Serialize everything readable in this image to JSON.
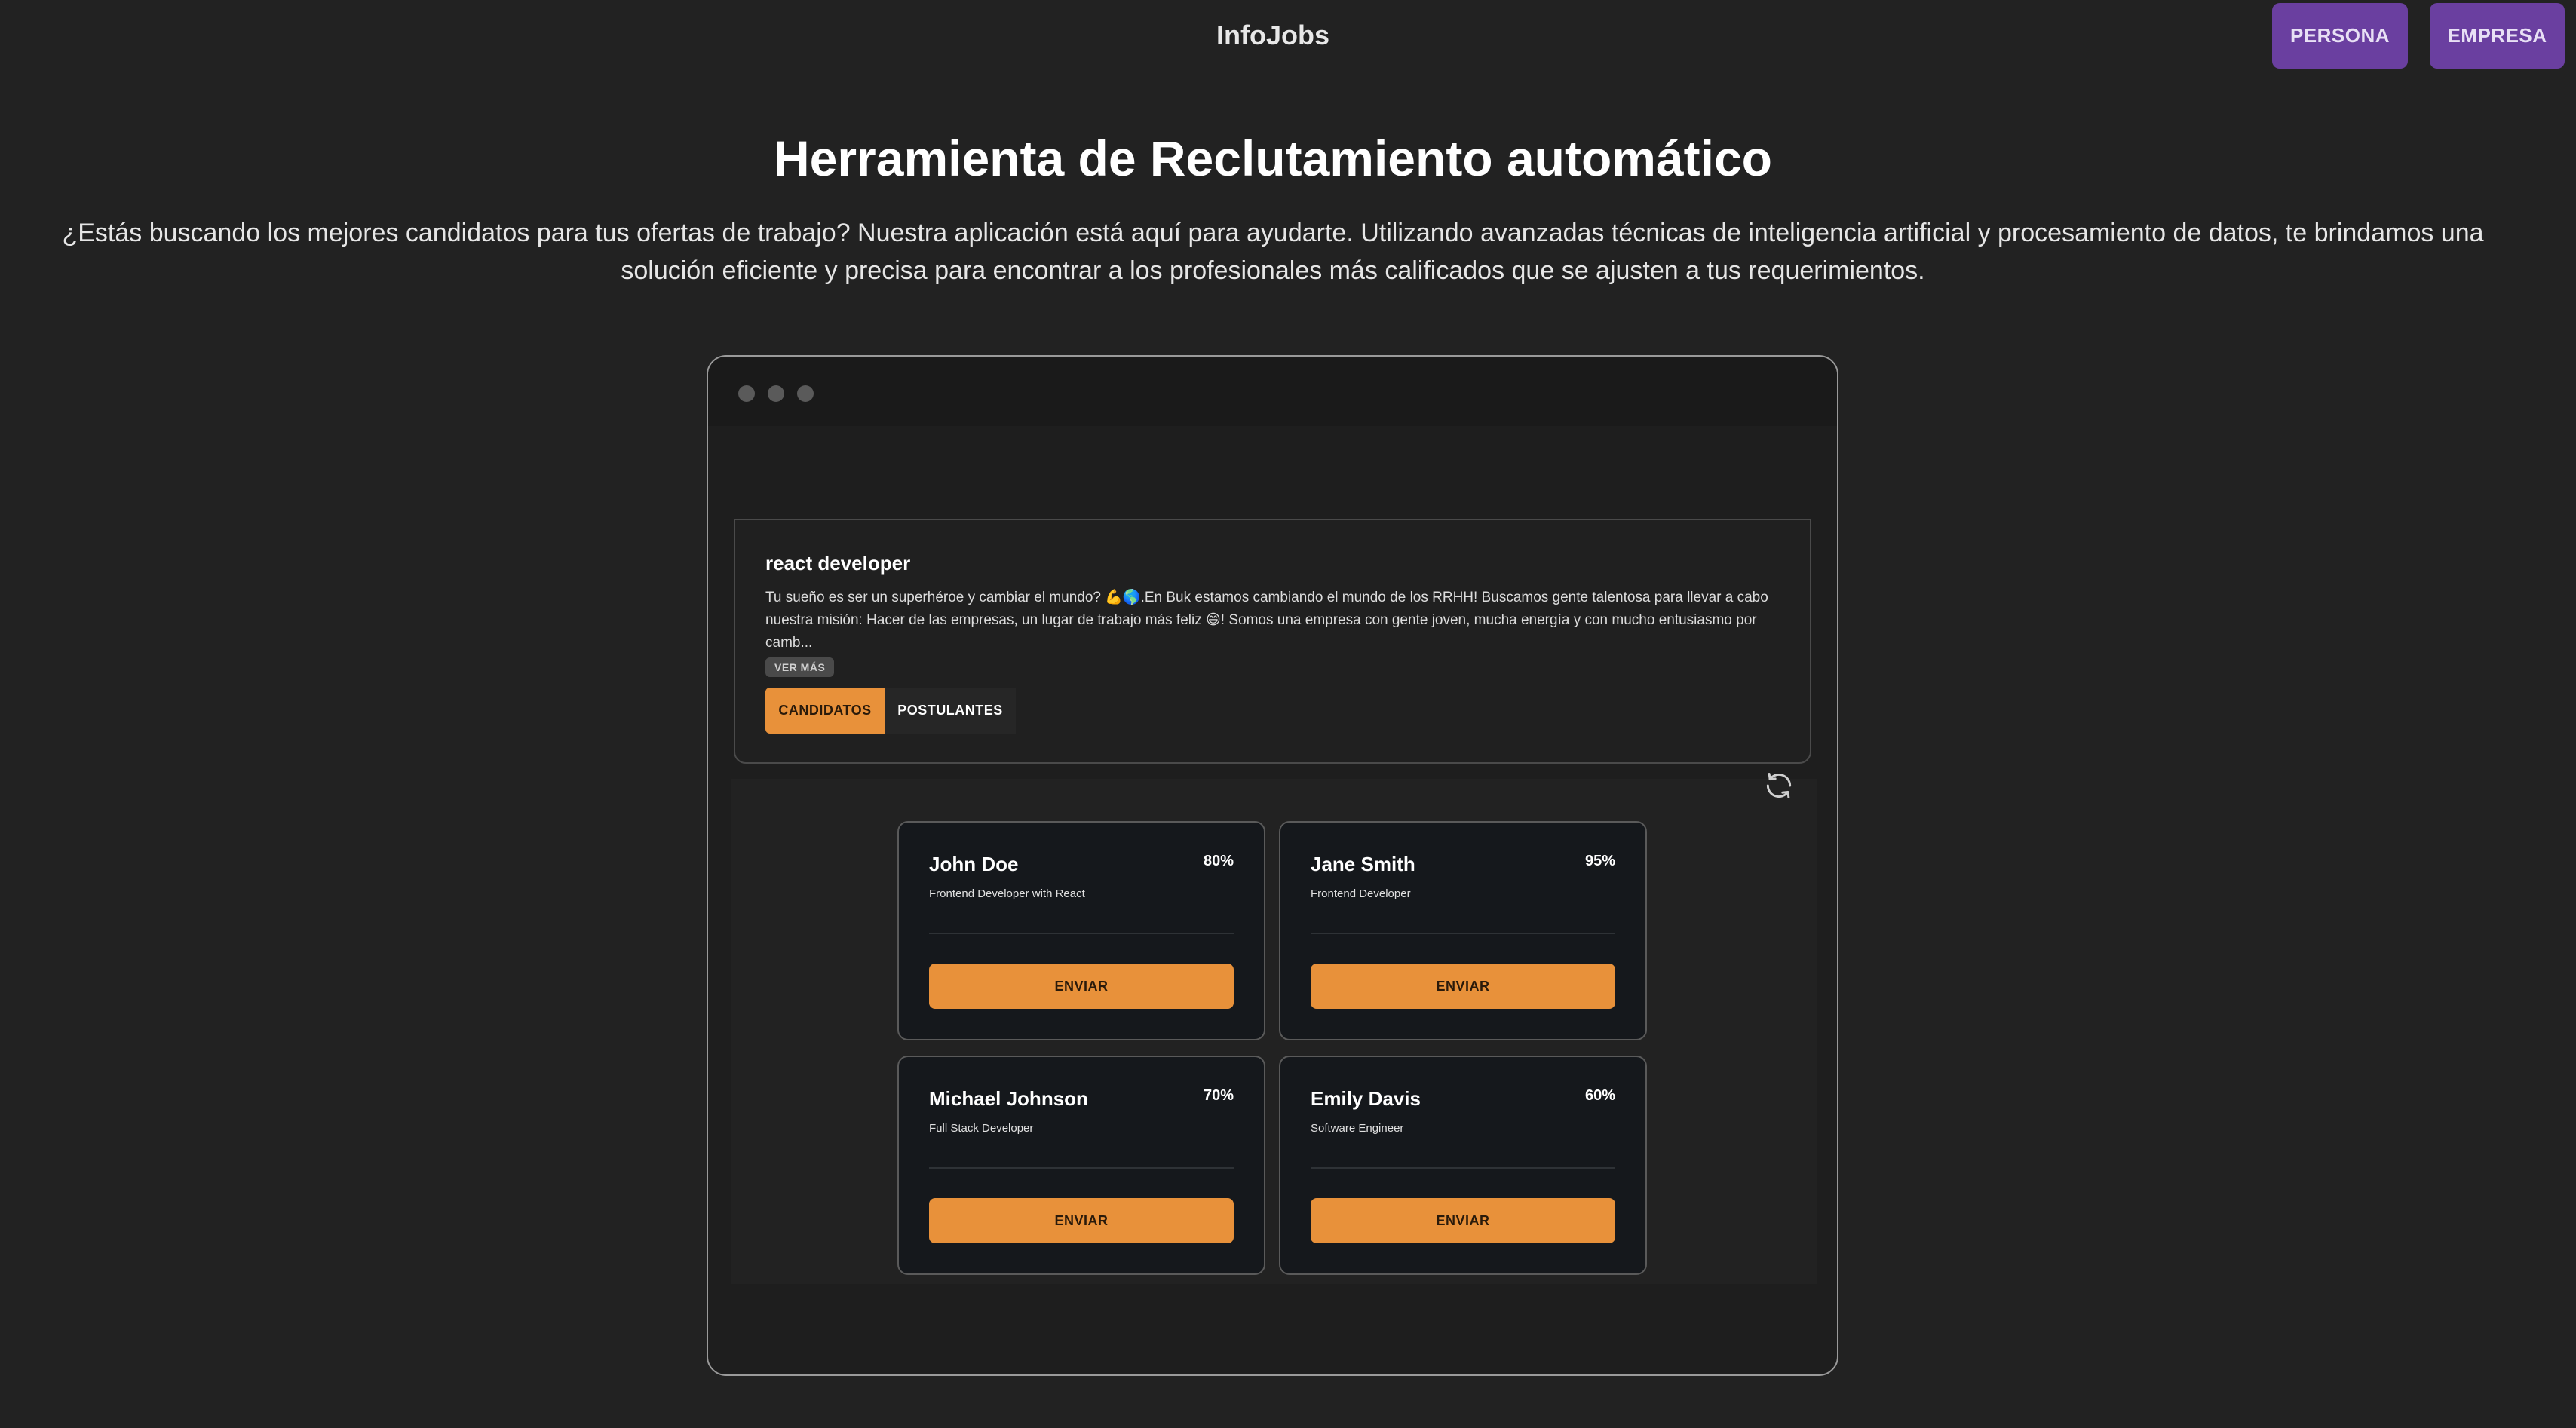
{
  "header": {
    "brand": "InfoJobs",
    "persona_label": "PERSONA",
    "empresa_label": "EMPRESA"
  },
  "hero": {
    "title": "Herramienta de Reclutamiento automático",
    "description": "¿Estás buscando los mejores candidatos para tus ofertas de trabajo? Nuestra aplicación está aquí para ayudarte. Utilizando avanzadas técnicas de inteligencia artificial y procesamiento de datos, te brindamos una solución eficiente y precisa para encontrar a los profesionales más calificados que se ajusten a tus requerimientos."
  },
  "job": {
    "title": "react developer",
    "description": "Tu sueño es ser un superhéroe y cambiar el mundo? 💪🌎.En Buk estamos cambiando el mundo de los RRHH! Buscamos gente talentosa para llevar a cabo nuestra misión: Hacer de las empresas, un lugar de trabajo más feliz 😄! Somos una empresa con gente joven, mucha energía y con mucho entusiasmo por camb...",
    "ver_mas": "VER MÁS",
    "tabs": [
      {
        "label": "CANDIDATOS",
        "active": true
      },
      {
        "label": "POSTULANTES",
        "active": false
      }
    ]
  },
  "candidates": [
    {
      "name": "John Doe",
      "match": "80%",
      "role": "Frontend Developer with React",
      "button": "ENVIAR"
    },
    {
      "name": "Jane Smith",
      "match": "95%",
      "role": "Frontend Developer",
      "button": "ENVIAR"
    },
    {
      "name": "Michael Johnson",
      "match": "70%",
      "role": "Full Stack Developer",
      "button": "ENVIAR"
    },
    {
      "name": "Emily Davis",
      "match": "60%",
      "role": "Software Engineer",
      "button": "ENVIAR"
    }
  ],
  "colors": {
    "background": "#222222",
    "nav_button": "#6a3fa0",
    "accent": "#e8913a"
  },
  "icons": {
    "refresh": "refresh-icon"
  }
}
